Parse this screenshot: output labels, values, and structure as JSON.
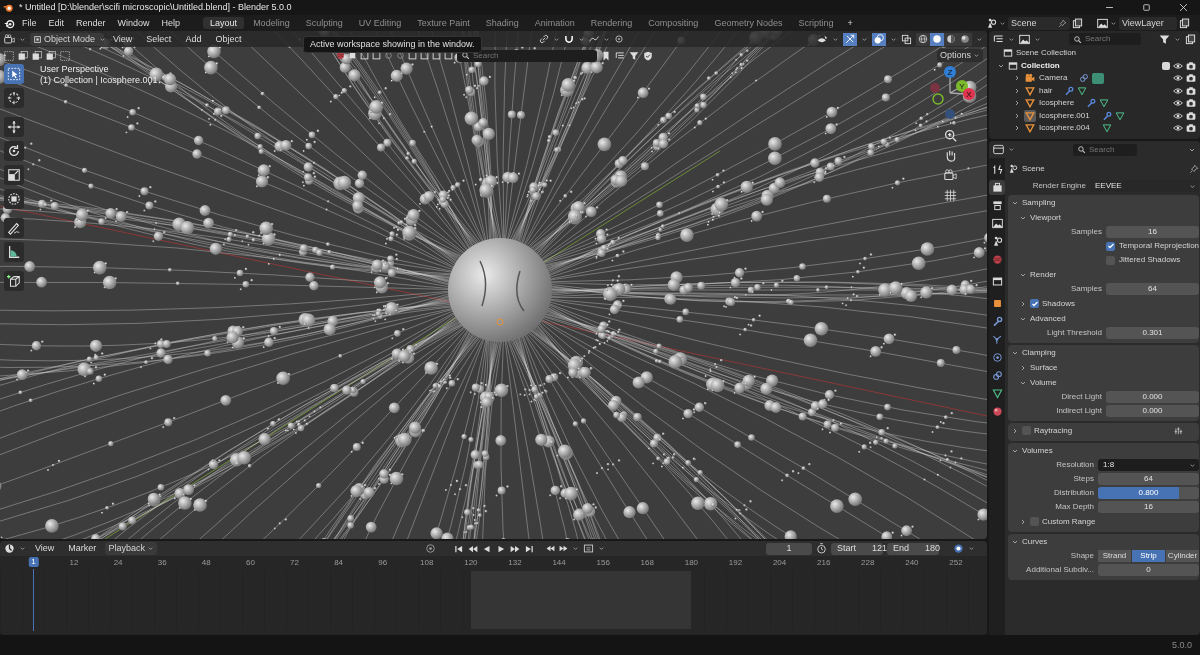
{
  "window": {
    "title": "* Untitled [D:\\blender\\scifi microscopic\\Untitled.blend] - Blender 5.0.0"
  },
  "menu": [
    "File",
    "Edit",
    "Render",
    "Window",
    "Help"
  ],
  "workspaces": [
    {
      "label": "Layout",
      "selected": true
    },
    {
      "label": "Modeling",
      "selected": false
    },
    {
      "label": "Sculpting",
      "selected": false
    },
    {
      "label": "UV Editing",
      "selected": false
    },
    {
      "label": "Texture Paint",
      "selected": false
    },
    {
      "label": "Shading",
      "selected": false
    },
    {
      "label": "Animation",
      "selected": false
    },
    {
      "label": "Rendering",
      "selected": false
    },
    {
      "label": "Compositing",
      "selected": false
    },
    {
      "label": "Geometry Nodes",
      "selected": false
    },
    {
      "label": "Scripting",
      "selected": false
    }
  ],
  "add_workspace": "+",
  "scene": {
    "name": "Scene"
  },
  "view_layer": {
    "name": "ViewLayer"
  },
  "viewport": {
    "mode": "Object Mode",
    "menus": [
      "View",
      "Select",
      "Add",
      "Object"
    ],
    "tooltip": "Active workspace showing in the window.",
    "search_placeholder": "Search",
    "options": "Options",
    "info": [
      "User Perspective",
      "(1) Collection | Icosphere.001"
    ],
    "tools": [
      {
        "selected": true
      },
      {
        "selected": false
      },
      {
        "selected": false
      },
      {
        "selected": false
      },
      {
        "selected": false
      },
      {
        "selected": false
      },
      {
        "selected": false
      },
      {
        "selected": false
      },
      {
        "selected": false
      }
    ],
    "shading": [
      {
        "selected": false
      },
      {
        "selected": true
      },
      {
        "selected": false
      },
      {
        "selected": false
      }
    ],
    "axes": [
      "Z",
      "Y",
      "X"
    ]
  },
  "outliner": {
    "search_placeholder": "Search",
    "root": "Scene Collection",
    "collection": {
      "name": "Collection",
      "expanded": true,
      "checked": true,
      "children": [
        {
          "name": "Camera",
          "kind": "camera",
          "expanded": false,
          "active": false,
          "modifiers": false
        },
        {
          "name": "hair",
          "kind": "mesh",
          "expanded": false,
          "active": false,
          "modifiers": true
        },
        {
          "name": "Icosphere",
          "kind": "mesh",
          "expanded": false,
          "active": false,
          "modifiers": true
        },
        {
          "name": "Icosphere.001",
          "kind": "mesh",
          "expanded": false,
          "active": true,
          "modifiers": true
        },
        {
          "name": "Icosphere.004",
          "kind": "mesh",
          "expanded": false,
          "active": false,
          "modifiers": false
        }
      ]
    }
  },
  "properties": {
    "search_placeholder": "Search",
    "context": "Scene",
    "tabs": [
      {
        "selected": false
      },
      {
        "selected": true
      },
      {
        "selected": false
      },
      {
        "selected": false
      },
      {
        "selected": false
      },
      {
        "selected": false
      },
      {
        "selected": false
      },
      {
        "selected": false
      },
      {
        "selected": false
      },
      {
        "selected": false
      },
      {
        "selected": false
      },
      {
        "selected": false
      },
      {
        "selected": false
      },
      {
        "selected": false
      }
    ],
    "render_engine": {
      "label": "Render Engine",
      "value": "EEVEE"
    },
    "panels": [
      {
        "kind": "panel",
        "label": "Sampling",
        "expanded": true,
        "children": [
          {
            "kind": "panel",
            "label": "Viewport",
            "expanded": true,
            "children": [
              {
                "kind": "number",
                "label": "Samples",
                "value": "16"
              },
              {
                "kind": "checkbox",
                "label": "Temporal Reprojection",
                "checked": true
              },
              {
                "kind": "checkbox",
                "label": "Jittered Shadows",
                "checked": false
              }
            ]
          },
          {
            "kind": "panel",
            "label": "Render",
            "expanded": true,
            "children": [
              {
                "kind": "number",
                "label": "Samples",
                "value": "64"
              }
            ]
          },
          {
            "kind": "panel",
            "label": "Shadows",
            "expanded": false,
            "checked": true
          },
          {
            "kind": "panel",
            "label": "Advanced",
            "expanded": true,
            "children": [
              {
                "kind": "number",
                "label": "Light Threshold",
                "value": "0.301"
              }
            ]
          }
        ]
      },
      {
        "kind": "panel",
        "label": "Clamping",
        "expanded": true,
        "children": [
          {
            "kind": "panel",
            "label": "Surface",
            "expanded": false
          },
          {
            "kind": "panel",
            "label": "Volume",
            "expanded": true,
            "children": [
              {
                "kind": "number",
                "label": "Direct Light",
                "value": "0.000"
              },
              {
                "kind": "number",
                "label": "Indirect Light",
                "value": "0.000"
              }
            ]
          }
        ]
      },
      {
        "kind": "panel",
        "label": "Raytracing",
        "expanded": false,
        "checked": false
      },
      {
        "kind": "panel",
        "label": "Volumes",
        "expanded": true,
        "children": [
          {
            "kind": "dropdown",
            "label": "Resolution",
            "value": "1:8"
          },
          {
            "kind": "number",
            "label": "Steps",
            "value": "64"
          },
          {
            "kind": "slider",
            "label": "Distribution",
            "value": "0.800",
            "level": 0.8
          },
          {
            "kind": "number",
            "label": "Max Depth",
            "value": "16"
          },
          {
            "kind": "panel",
            "label": "Custom Range",
            "expanded": false,
            "checked": false
          }
        ]
      },
      {
        "kind": "panel",
        "label": "Curves",
        "expanded": true,
        "children": [
          {
            "kind": "segmented",
            "label": "Shape",
            "options": [
              {
                "label": "Strand",
                "selected": false
              },
              {
                "label": "Strip",
                "selected": true
              },
              {
                "label": "Cylinder",
                "selected": false
              }
            ]
          },
          {
            "kind": "number",
            "label": "Additional Subdiv...",
            "value": "0"
          }
        ]
      }
    ]
  },
  "timeline": {
    "menus": [
      "View",
      "Marker",
      "Playback"
    ],
    "current_frame": "1",
    "start": {
      "label": "Start",
      "value": "121"
    },
    "end": {
      "label": "End",
      "value": "180"
    },
    "playhead": "1",
    "ruler": [
      "12",
      "24",
      "36",
      "48",
      "60",
      "72",
      "84",
      "96",
      "108",
      "120",
      "132",
      "144",
      "156",
      "168",
      "180",
      "192",
      "204",
      "216",
      "228",
      "240",
      "252"
    ]
  },
  "status": {
    "version": "5.0.0"
  }
}
